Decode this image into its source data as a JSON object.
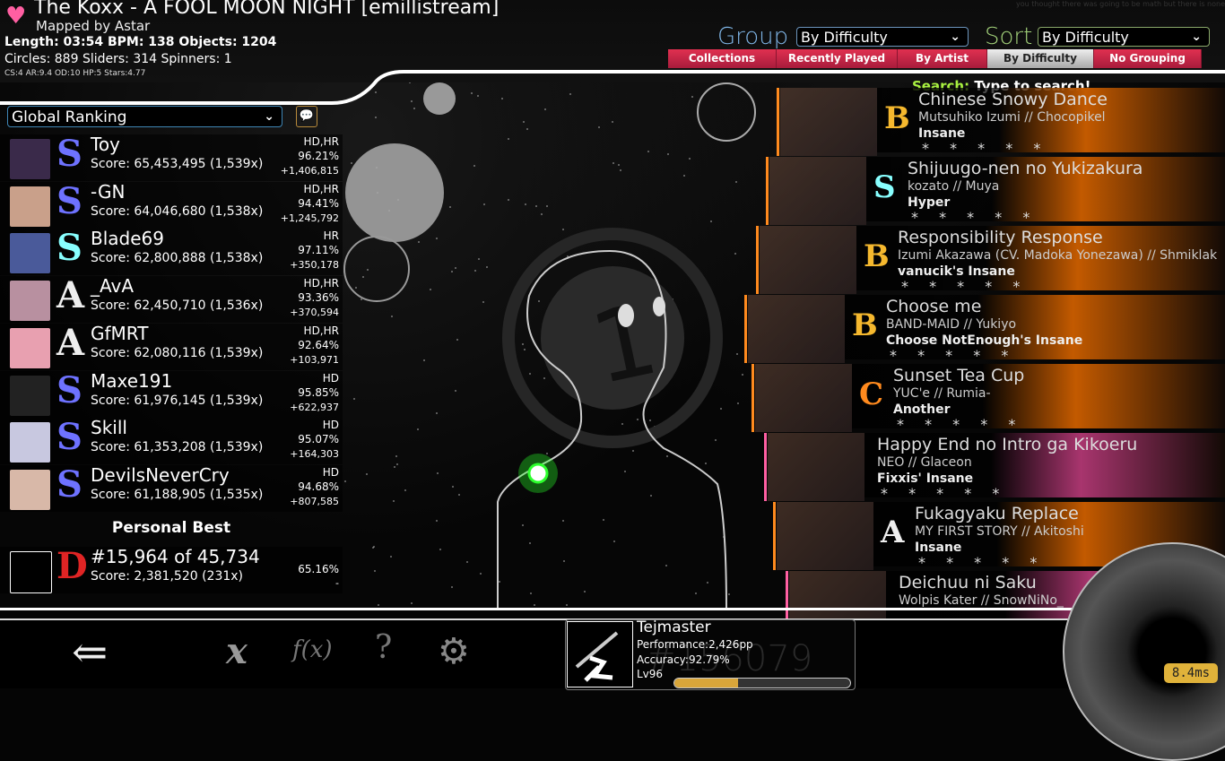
{
  "header": {
    "title": "The Koxx - A FOOL MOON NIGHT [emillistream]",
    "mapper": "Mapped by Astar",
    "stats_line1": "Length: 03:54 BPM: 138 Objects: 1204",
    "stats_line2": "Circles: 889 Sliders: 314 Spinners: 1",
    "stats_line3": "CS:4 AR:9.4 OD:10 HP:5 Stars:4.77",
    "favourite_icon": "heart-icon",
    "corner_text": "you thought there was going to be math but there is none"
  },
  "controls": {
    "group_label": "Group",
    "group_value": "By Difficulty",
    "sort_label": "Sort",
    "sort_value": "By Difficulty",
    "tabs": [
      {
        "label": "Collections",
        "active": false
      },
      {
        "label": "Recently Played",
        "active": false
      },
      {
        "label": "By Artist",
        "active": false
      },
      {
        "label": "By Difficulty",
        "active": true
      },
      {
        "label": "No Grouping",
        "active": false
      }
    ],
    "search_label": "Search:",
    "search_placeholder": "Type to search!"
  },
  "leaderboard": {
    "type_value": "Global Ranking",
    "scores": [
      {
        "name": "Toy",
        "grade": "S",
        "score": "Score: 65,453,495 (1,539x)",
        "mods": "HD,HR",
        "accuracy": "96.21%",
        "diff": "+1,406,815"
      },
      {
        "name": "-GN",
        "grade": "S",
        "score": "Score: 64,046,680 (1,538x)",
        "mods": "HD,HR",
        "accuracy": "94.41%",
        "diff": "+1,245,792"
      },
      {
        "name": "Blade69",
        "grade": "S",
        "score": "Score: 62,800,888 (1,538x)",
        "mods": "HR",
        "accuracy": "97.11%",
        "diff": "+350,178"
      },
      {
        "name": "_AvA",
        "grade": "A",
        "score": "Score: 62,450,710 (1,536x)",
        "mods": "HD,HR",
        "accuracy": "93.36%",
        "diff": "+370,594"
      },
      {
        "name": "GfMRT",
        "grade": "A",
        "score": "Score: 62,080,116 (1,539x)",
        "mods": "HD,HR",
        "accuracy": "92.64%",
        "diff": "+103,971"
      },
      {
        "name": "Maxe191",
        "grade": "S",
        "score": "Score: 61,976,145 (1,539x)",
        "mods": "HD",
        "accuracy": "95.85%",
        "diff": "+622,937"
      },
      {
        "name": "Skill",
        "grade": "S",
        "score": "Score: 61,353,208 (1,539x)",
        "mods": "HD",
        "accuracy": "95.07%",
        "diff": "+164,303"
      },
      {
        "name": "DevilsNeverCry",
        "grade": "S",
        "score": "Score: 61,188,905 (1,535x)",
        "mods": "HD",
        "accuracy": "94.68%",
        "diff": "+807,585"
      }
    ],
    "personal_best_label": "Personal Best",
    "personal_best": {
      "name": "#15,964 of 45,734",
      "grade": "D",
      "score": "Score: 2,381,520 (231x)",
      "mods": "",
      "accuracy": "65.16%",
      "diff": "-"
    }
  },
  "songs": [
    {
      "title": "Chinese Snowy Dance",
      "artist": "Mutsuhiko Izumi // Chocopikel",
      "difficulty": "Insane",
      "grade": "B",
      "stars": "* * * * *",
      "color": "#c35a00"
    },
    {
      "title": "Shijuugo-nen no Yukizakura",
      "artist": "kozato // Muya",
      "difficulty": "Hyper",
      "grade": "S",
      "stars": "* * * * *",
      "color": "#c35a00"
    },
    {
      "title": "Responsibility Response",
      "artist": "Izumi Akazawa (CV. Madoka Yonezawa) // Shmiklak",
      "difficulty": "vanucik's Insane",
      "grade": "B",
      "stars": "* * * * *",
      "color": "#c35a00"
    },
    {
      "title": "Choose me",
      "artist": "BAND-MAID // Yukiyo",
      "difficulty": "Choose NotEnough's Insane",
      "grade": "B",
      "stars": "* * * * *",
      "color": "#c35a00"
    },
    {
      "title": "Sunset Tea Cup",
      "artist": "YUC'e // Rumia-",
      "difficulty": "Another",
      "grade": "C",
      "stars": "* * * * *",
      "color": "#c35a00"
    },
    {
      "title": "Happy End no Intro ga Kikoeru",
      "artist": "NEO // Glaceon",
      "difficulty": "Fixxis' Insane",
      "grade": "",
      "stars": "* * * * *",
      "color": "#a8356e"
    },
    {
      "title": "Fukagyaku Replace",
      "artist": "MY FIRST STORY // Akitoshi",
      "difficulty": "Insane",
      "grade": "A",
      "stars": "* * * * *",
      "color": "#c35a00"
    },
    {
      "title": "Deichuu ni Saku",
      "artist": "Wolpis Kater // SnowNiNo_",
      "difficulty": "",
      "grade": "",
      "stars": "",
      "color": "#a8356e"
    }
  ],
  "footer": {
    "back_icon": "back-arrow-icon",
    "mode_label": "x",
    "mods_label": "f(x)",
    "random_label": "?",
    "options_icon": "gear-icon",
    "user": {
      "name": "Tejmaster",
      "performance": "Performance:2,426pp",
      "accuracy": "Accuracy:92.79%",
      "level": "Lv96",
      "rank": "#156079",
      "level_progress": 0.36
    },
    "latency": "8.4ms"
  },
  "colors": {
    "tab_red": "#c8203f",
    "group_blue": "#7fb5e6",
    "sort_green": "#a3d27a",
    "search_green": "#a8f040",
    "grade_S_blue": "#6e72ff",
    "grade_S_silver": "#8ff",
    "grade_B": "#f5b82e",
    "grade_C": "#ff8a1e",
    "grade_D": "#e02424",
    "level_bar": "#d9a63a"
  }
}
